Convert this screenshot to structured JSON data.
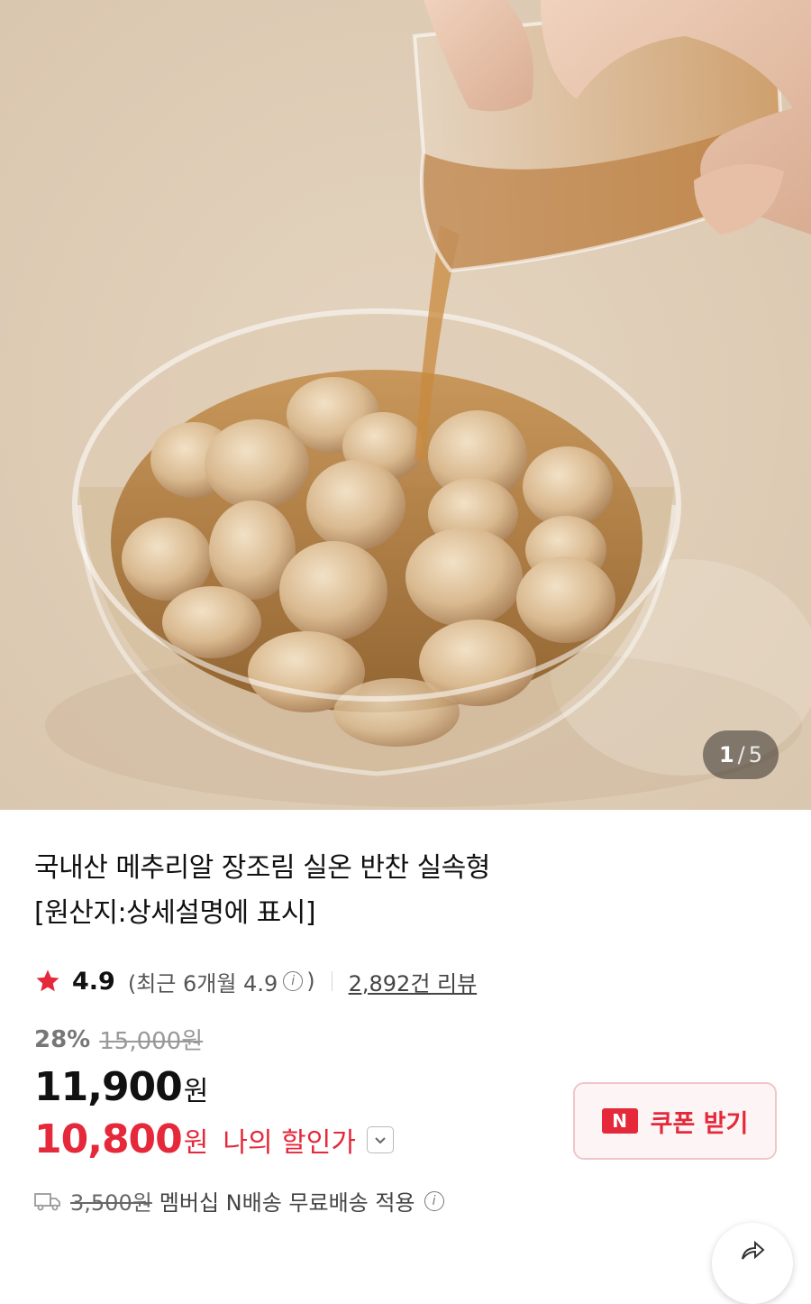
{
  "hero": {
    "image_alt": "메추리알 장조림",
    "counter_current": "1",
    "counter_separator": "/",
    "counter_total": "5"
  },
  "product": {
    "title_line1": "국내산 메추리알 장조림 실온 반찬 실속형",
    "title_line2": "[원산지:상세설명에 표시]",
    "rating": "4.9",
    "recent_rating_text": "(최근 6개월 4.9",
    "recent_rating_close": ")",
    "review_link": "2,892건 리뷰",
    "discount_rate": "28%",
    "original_price": "15,000원",
    "price": "11,900",
    "price_unit": "원",
    "my_price": "10,800",
    "my_price_unit": "원",
    "my_price_label": "나의 할인가",
    "coupon_badge": "N",
    "coupon_label": "쿠폰 받기",
    "shipping_fee": "3,500원",
    "shipping_text": "멤버십 N배송 무료배송 적용"
  },
  "colors": {
    "accent_red": "#e5283a",
    "coupon_bg": "#fdf5f5",
    "coupon_border": "#f0c6c8"
  },
  "icons": [
    "star-icon",
    "info-icon",
    "chevron-down-icon",
    "truck-icon",
    "share-icon"
  ]
}
